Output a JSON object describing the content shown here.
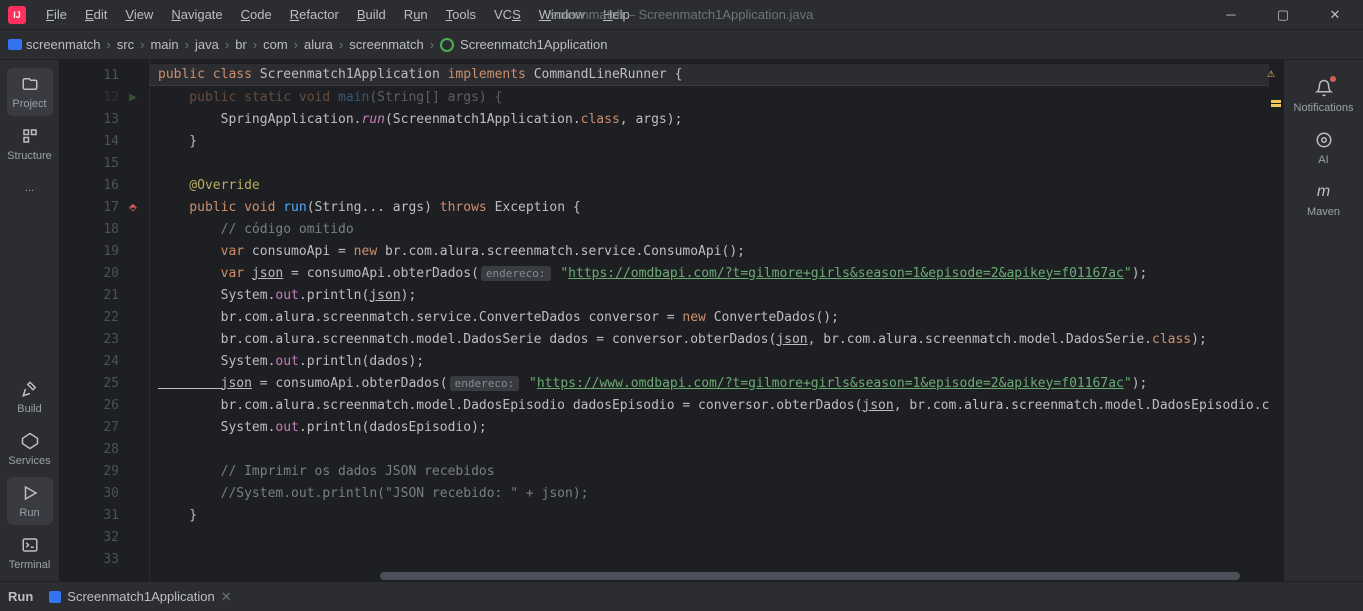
{
  "app_icon": "IJ",
  "menu": {
    "file": "File",
    "edit": "Edit",
    "view": "View",
    "navigate": "Navigate",
    "code": "Code",
    "refactor": "Refactor",
    "build": "Build",
    "run": "Run",
    "tools": "Tools",
    "vcs": "VCS",
    "window": "Window",
    "help": "Help"
  },
  "title": "screenmatch – Screenmatch1Application.java",
  "breadcrumb": {
    "items": [
      "screenmatch",
      "src",
      "main",
      "java",
      "br",
      "com",
      "alura",
      "screenmatch"
    ],
    "class": "Screenmatch1Application"
  },
  "left_sidebar": {
    "project": "Project",
    "structure": "Structure",
    "more": "...",
    "build": "Build",
    "services": "Services",
    "run": "Run",
    "terminal": "Terminal"
  },
  "right_sidebar": {
    "notifications": "Notifications",
    "ai": "AI",
    "maven": "Maven",
    "maven_glyph": "m"
  },
  "lines": {
    "n11": "11",
    "n12": "12",
    "n13": "13",
    "n14": "14",
    "n15": "15",
    "n16": "16",
    "n17": "17",
    "n18": "18",
    "n19": "19",
    "n20": "20",
    "n21": "21",
    "n22": "22",
    "n23": "23",
    "n24": "24",
    "n25": "25",
    "n26": "26",
    "n27": "27",
    "n28": "28",
    "n29": "29",
    "n30": "30",
    "n31": "31",
    "n32": "32",
    "n33": "33"
  },
  "code": {
    "l11_public": "public ",
    "l11_class": "class ",
    "l11_name": "Screenmatch1Application ",
    "l11_implements": "implements ",
    "l11_cli": "CommandLineRunner ",
    "l11_brace": "{",
    "l12_psv": "    public static void ",
    "l12_main": "main",
    "l12_args": "(String[] args) {",
    "l13_pre": "        SpringApplication.",
    "l13_run": "run",
    "l13_post1": "(Screenmatch1Application.",
    "l13_class": "class",
    "l13_post2": ", args);",
    "l14": "    }",
    "l16_anno": "    @Override",
    "l17_pub": "    public ",
    "l17_void": "void ",
    "l17_run": "run",
    "l17_args": "(String... args) ",
    "l17_throws": "throws ",
    "l17_exc": "Exception {",
    "l18": "        // código omitido",
    "l19_var": "        var ",
    "l19_name": "consumoApi = ",
    "l19_new": "new ",
    "l19_rest": "br.com.alura.screenmatch.service.ConsumoApi();",
    "l20_var": "        var ",
    "l20_json": "json",
    "l20_eq": " = consumoApi.obterDados(",
    "l20_hint": "endereco:",
    "l20_q1": " \"",
    "l20_url": "https://omdbapi.com/?t=gilmore+girls&season=1&episode=2&apikey=f01167ac",
    "l20_q2": "\"",
    "l20_end": ");",
    "l21_pre": "        System.",
    "l21_out": "out",
    "l21_print": ".println(",
    "l21_json": "json",
    "l21_end": ");",
    "l22_pre": "        br.com.alura.screenmatch.service.ConverteDados conversor = ",
    "l22_new": "new ",
    "l22_rest": "ConverteDados();",
    "l23_pre": "        br.com.alura.screenmatch.model.DadosSerie dados = conversor.obterDados(",
    "l23_json": "json",
    "l23_mid": ", br.com.alura.screenmatch.model.DadosSerie.",
    "l23_class": "class",
    "l23_end": ");",
    "l24_pre": "        System.",
    "l24_out": "out",
    "l24_rest": ".println(dados);",
    "l25_json": "        json",
    "l25_eq": " = consumoApi.obterDados(",
    "l25_hint": "endereco:",
    "l25_q1": " \"",
    "l25_url": "https://www.omdbapi.com/?t=gilmore+girls&season=1&episode=2&apikey=f01167ac",
    "l25_q2": "\"",
    "l25_end": ");",
    "l26_pre": "        br.com.alura.screenmatch.model.DadosEpisodio dadosEpisodio = conversor.obterDados(",
    "l26_json": "json",
    "l26_rest": ", br.com.alura.screenmatch.model.DadosEpisodio.class);",
    "l27_pre": "        System.",
    "l27_out": "out",
    "l27_rest": ".println(dadosEpisodio);",
    "l29": "        // Imprimir os dados JSON recebidos",
    "l30": "        //System.out.println(\"JSON recebido: \" + json);",
    "l31": "    }"
  },
  "bottom": {
    "run": "Run",
    "tab": "Screenmatch1Application"
  }
}
